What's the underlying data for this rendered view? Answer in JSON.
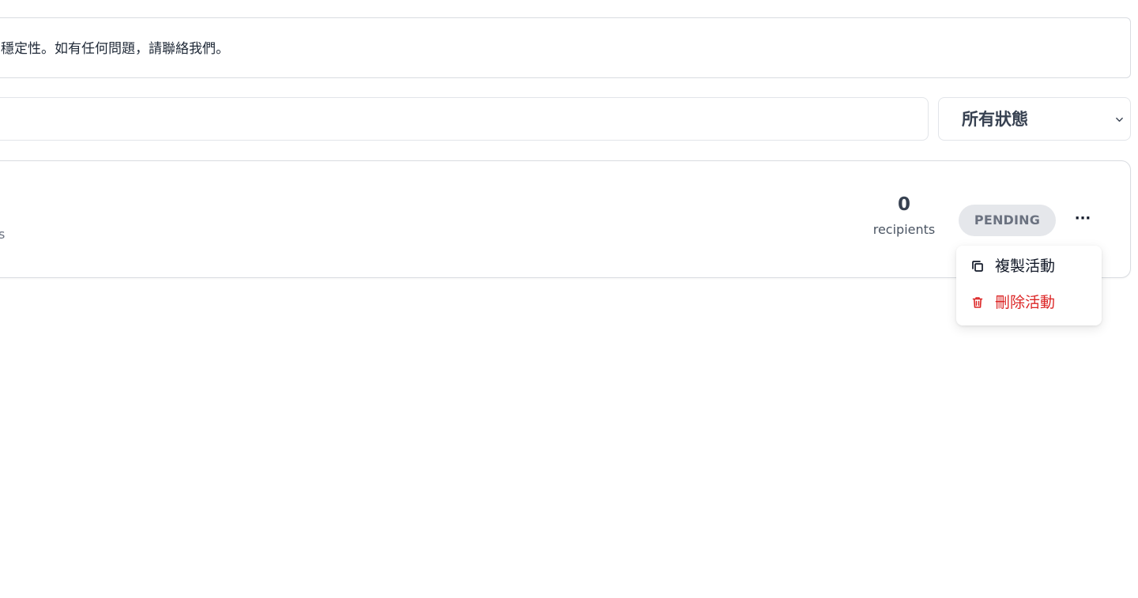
{
  "notice": {
    "text": "穩定性。如有任何問題，請聯絡我們。"
  },
  "filters": {
    "search_value": "",
    "status_select": {
      "selected": "所有狀態",
      "icon": "chevron-down-icon"
    }
  },
  "campaign": {
    "left_fragment": "s",
    "recipients": {
      "count": "0",
      "label": "recipients"
    },
    "status": "PENDING",
    "more_label": "···"
  },
  "dropdown": {
    "items": [
      {
        "label": "複製活動",
        "icon": "copy-icon"
      },
      {
        "label": "刪除活動",
        "icon": "trash-icon"
      }
    ]
  },
  "colors": {
    "danger": "#dc2626",
    "badge_bg": "#e5e7eb",
    "badge_text": "#6b7280",
    "border": "#d9dce1"
  }
}
